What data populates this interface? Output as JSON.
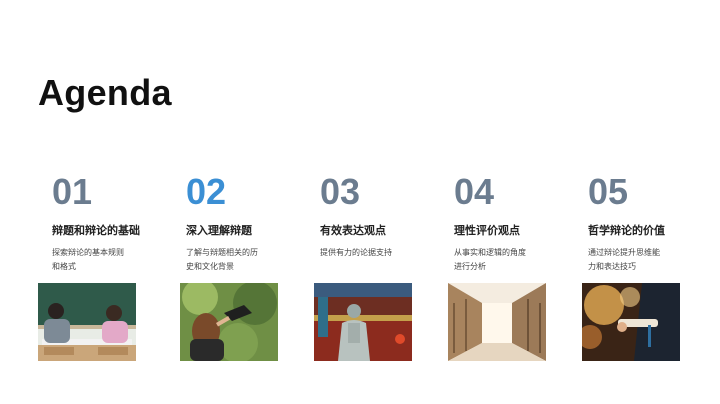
{
  "slide": {
    "title": "Agenda",
    "items": [
      {
        "number": "01",
        "heading": "辩题和辩论的基础",
        "description": "探索辩论的基本规则\n和格式",
        "image": "classroom-students-photo"
      },
      {
        "number": "02",
        "heading": "深入理解辩题",
        "description": "了解与辩题相关的历\n史和文化背景",
        "image": "graduate-cap-toss-photo"
      },
      {
        "number": "03",
        "heading": "有效表达观点",
        "description": "提供有力的论据支持",
        "image": "confucius-statue-photo"
      },
      {
        "number": "04",
        "heading": "理性评价观点",
        "description": "从事实和逻辑的角度\n进行分析",
        "image": "library-corridor-photo"
      },
      {
        "number": "05",
        "heading": "哲学辩论的价值",
        "description": "通过辩论提升思维能\n力和表达技巧",
        "image": "graduate-diploma-photo"
      }
    ],
    "colors": {
      "number": "#6b7c8f",
      "number_accent": "#3b8fd4",
      "text": "#222222"
    }
  }
}
